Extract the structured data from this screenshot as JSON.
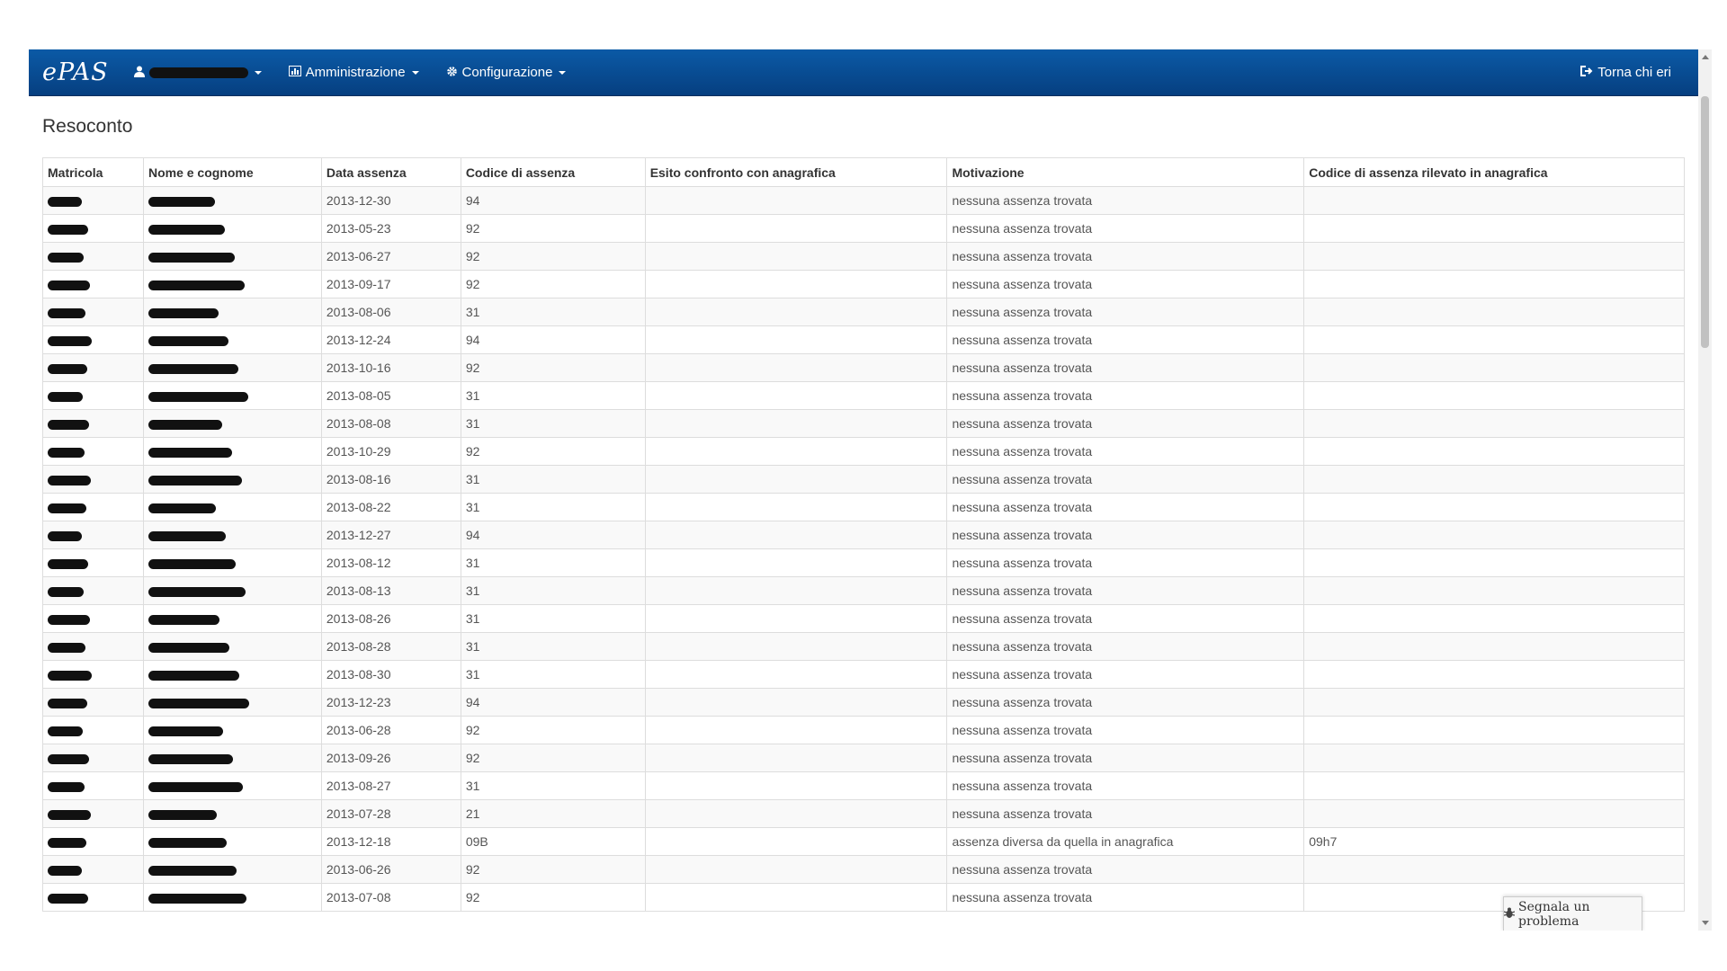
{
  "navbar": {
    "brand": "ePAS",
    "user_icon": "user-icon",
    "menus": [
      {
        "label": "Amministrazione",
        "icon": "chart-icon"
      },
      {
        "label": "Configurazione",
        "icon": "gear-icon"
      }
    ],
    "back": {
      "label": "Torna chi eri",
      "icon": "sign-out-icon"
    },
    "color": "#0b5aa6"
  },
  "page": {
    "title": "Resoconto"
  },
  "table": {
    "headers": [
      "Matricola",
      "Nome e cognome",
      "Data assenza",
      "Codice di assenza",
      "Esito confronto con anagrafica",
      "Motivazione",
      "Codice di assenza rilevato in anagrafica"
    ],
    "rows": [
      {
        "date": "2013-12-30",
        "code": "94",
        "esito": "",
        "motivazione": "nessuna assenza trovata",
        "rilevato": ""
      },
      {
        "date": "2013-05-23",
        "code": "92",
        "esito": "",
        "motivazione": "nessuna assenza trovata",
        "rilevato": ""
      },
      {
        "date": "2013-06-27",
        "code": "92",
        "esito": "",
        "motivazione": "nessuna assenza trovata",
        "rilevato": ""
      },
      {
        "date": "2013-09-17",
        "code": "92",
        "esito": "",
        "motivazione": "nessuna assenza trovata",
        "rilevato": ""
      },
      {
        "date": "2013-08-06",
        "code": "31",
        "esito": "",
        "motivazione": "nessuna assenza trovata",
        "rilevato": ""
      },
      {
        "date": "2013-12-24",
        "code": "94",
        "esito": "",
        "motivazione": "nessuna assenza trovata",
        "rilevato": ""
      },
      {
        "date": "2013-10-16",
        "code": "92",
        "esito": "",
        "motivazione": "nessuna assenza trovata",
        "rilevato": ""
      },
      {
        "date": "2013-08-05",
        "code": "31",
        "esito": "",
        "motivazione": "nessuna assenza trovata",
        "rilevato": ""
      },
      {
        "date": "2013-08-08",
        "code": "31",
        "esito": "",
        "motivazione": "nessuna assenza trovata",
        "rilevato": ""
      },
      {
        "date": "2013-10-29",
        "code": "92",
        "esito": "",
        "motivazione": "nessuna assenza trovata",
        "rilevato": ""
      },
      {
        "date": "2013-08-16",
        "code": "31",
        "esito": "",
        "motivazione": "nessuna assenza trovata",
        "rilevato": ""
      },
      {
        "date": "2013-08-22",
        "code": "31",
        "esito": "",
        "motivazione": "nessuna assenza trovata",
        "rilevato": ""
      },
      {
        "date": "2013-12-27",
        "code": "94",
        "esito": "",
        "motivazione": "nessuna assenza trovata",
        "rilevato": ""
      },
      {
        "date": "2013-08-12",
        "code": "31",
        "esito": "",
        "motivazione": "nessuna assenza trovata",
        "rilevato": ""
      },
      {
        "date": "2013-08-13",
        "code": "31",
        "esito": "",
        "motivazione": "nessuna assenza trovata",
        "rilevato": ""
      },
      {
        "date": "2013-08-26",
        "code": "31",
        "esito": "",
        "motivazione": "nessuna assenza trovata",
        "rilevato": ""
      },
      {
        "date": "2013-08-28",
        "code": "31",
        "esito": "",
        "motivazione": "nessuna assenza trovata",
        "rilevato": ""
      },
      {
        "date": "2013-08-30",
        "code": "31",
        "esito": "",
        "motivazione": "nessuna assenza trovata",
        "rilevato": ""
      },
      {
        "date": "2013-12-23",
        "code": "94",
        "esito": "",
        "motivazione": "nessuna assenza trovata",
        "rilevato": ""
      },
      {
        "date": "2013-06-28",
        "code": "92",
        "esito": "",
        "motivazione": "nessuna assenza trovata",
        "rilevato": ""
      },
      {
        "date": "2013-09-26",
        "code": "92",
        "esito": "",
        "motivazione": "nessuna assenza trovata",
        "rilevato": ""
      },
      {
        "date": "2013-08-27",
        "code": "31",
        "esito": "",
        "motivazione": "nessuna assenza trovata",
        "rilevato": ""
      },
      {
        "date": "2013-07-28",
        "code": "21",
        "esito": "",
        "motivazione": "nessuna assenza trovata",
        "rilevato": ""
      },
      {
        "date": "2013-12-18",
        "code": "09B",
        "esito": "",
        "motivazione": "assenza diversa da quella in anagrafica",
        "rilevato": "09h7"
      },
      {
        "date": "2013-06-26",
        "code": "92",
        "esito": "",
        "motivazione": "nessuna assenza trovata",
        "rilevato": ""
      },
      {
        "date": "2013-07-08",
        "code": "92",
        "esito": "",
        "motivazione": "nessuna assenza trovata",
        "rilevato": ""
      }
    ]
  },
  "bug_report": {
    "label": "Segnala un problema",
    "icon": "bug-icon"
  }
}
